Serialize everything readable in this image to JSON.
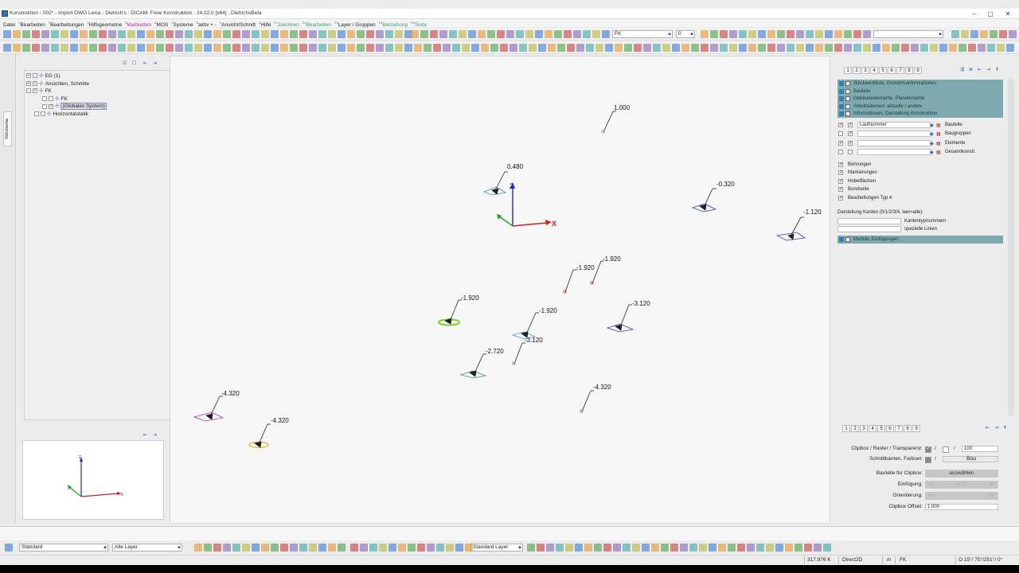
{
  "window": {
    "title": "Konstruktion - 002* - Import DWG Leica - Dietrich's : DICAM: Freie Konstruktion : 24.02.0 [x64] ,   DietrichsBeta"
  },
  "menu": [
    {
      "num": "",
      "label": "Datei",
      "color": "#222"
    },
    {
      "num": "2",
      "label": "Bearbeiten",
      "color": "#222"
    },
    {
      "num": "3",
      "label": "Bearbeitungen",
      "color": "#222"
    },
    {
      "num": "4",
      "label": "Hilfsgeometrie",
      "color": "#222"
    },
    {
      "num": "5",
      "label": "Maßketten",
      "color": "#b0309a"
    },
    {
      "num": "6",
      "label": "MOS",
      "color": "#222"
    },
    {
      "num": "7",
      "label": "Systeme",
      "color": "#222"
    },
    {
      "num": "8",
      "label": "aktiv + -",
      "color": "#222"
    },
    {
      "num": "9",
      "label": "Ansicht/Schnitt",
      "color": "#222"
    },
    {
      "num": "0",
      "label": "Hilfe",
      "color": "#222"
    },
    {
      "num": "F1",
      "label": "Zeichnen",
      "color": "#3aa07a"
    },
    {
      "num": "F2",
      "label": "Bearbeiten",
      "color": "#3aa07a"
    },
    {
      "num": "F3",
      "label": "Layer / Gruppen",
      "color": "#222"
    },
    {
      "num": "F4",
      "label": "Bemaßung",
      "color": "#3aa07a"
    },
    {
      "num": "F5",
      "label": "Texte",
      "color": "#3aa07a"
    }
  ],
  "toolbar": {
    "system_select": "FK",
    "number_select": "0",
    "empty_select": ""
  },
  "left_strip": {
    "tab": "Volumenta"
  },
  "tree": [
    {
      "label": "EG (1)",
      "indent": 0,
      "expander": "+",
      "checked": false,
      "selected": false
    },
    {
      "label": "Ansichten, Schnitte",
      "indent": 0,
      "expander": "+",
      "checked": true,
      "selected": false
    },
    {
      "label": "FK",
      "indent": 0,
      "expander": "-",
      "checked": true,
      "selected": false
    },
    {
      "label": "FK",
      "indent": 2,
      "expander": "",
      "checked": false,
      "selected": false
    },
    {
      "label": "(Globales System)",
      "indent": 2,
      "expander": "",
      "checked": true,
      "selected": true
    },
    {
      "label": "Horizontalstatik",
      "indent": 1,
      "expander": "",
      "checked": false,
      "selected": false
    }
  ],
  "canvas": {
    "labels": [
      {
        "text": "1.000",
        "color": "#c0c0c0"
      },
      {
        "text": "0.480",
        "color": "#4a8aa8"
      },
      {
        "text": "-0.320",
        "color": "#3a3ab0"
      },
      {
        "text": "-1.120",
        "color": "#3a3ab0"
      },
      {
        "text": "-1.920",
        "color": "#c04040"
      },
      {
        "text": "-1.920",
        "color": "#c04040"
      },
      {
        "text": "-1.920",
        "color": "#7ad030"
      },
      {
        "text": "-1.920",
        "color": "#4a9ad0"
      },
      {
        "text": "-3.120",
        "color": "#3a3ab0"
      },
      {
        "text": "-3.120",
        "color": "#8a8a8a"
      },
      {
        "text": "-2.720",
        "color": "#3a9a50"
      },
      {
        "text": "-4.320",
        "color": "#b030b0"
      },
      {
        "text": "-4.320",
        "color": "#e0b020"
      },
      {
        "text": "-4.320",
        "color": "#8a8a8a"
      }
    ],
    "axes": {
      "x": "X",
      "z": "Z"
    }
  },
  "mini_axes": {
    "x": "x",
    "z": "z"
  },
  "right_panel": {
    "sections": [
      {
        "label": "Stückwerkliste, Grundrissinformationen"
      },
      {
        "label": "Bauteile"
      },
      {
        "label": "Gebäudeelemente, Planelemente"
      },
      {
        "label": "Arbeitsebenen: aktuelle / andere"
      },
      {
        "label": "Informationen, Darstellung Konstruktion"
      }
    ],
    "info_rows": [
      {
        "field": "Laufnummer",
        "label": "Bauteile"
      },
      {
        "field": "",
        "label": "Baugruppen"
      },
      {
        "field": "",
        "label": "Elemente"
      },
      {
        "field": "",
        "label": "Gesamtkonstr."
      }
    ],
    "check_items": [
      "Bohrungen",
      "Markierungen",
      "Hobelflächen",
      "Bundseite",
      "Bearbeitungen Typ 4"
    ],
    "kanten_title": "Darstellung Kanten (0/1/2/3/4, leer=alle):",
    "kanten_rows": [
      "Kantentypnummern",
      "spezielle Linien"
    ],
    "module_section": "Module, Einfügungen",
    "tabs": [
      "1",
      "2",
      "3",
      "4",
      "5",
      "6",
      "7",
      "8",
      "9"
    ]
  },
  "clip_panel": {
    "tabs": [
      "1",
      "2",
      "3",
      "4",
      "5",
      "6",
      "7",
      "8",
      "9"
    ],
    "clipbox_label": "Clipbox / Raster / Transparenz:",
    "clipbox_value": "100",
    "schnitt_label": "Schnittkanten, Farbset:",
    "schnitt_value": "Blau",
    "bauteile_label": "Bauteile für Clipbox:",
    "auswaehlen": "auswählen",
    "einfuegung_label": "Einfügung:",
    "einfuegung_value": "0 / 0",
    "orientierung_label": "Orientierung:",
    "offset_label": "Clipbox Offset:",
    "offset_value": "1.000",
    "prev": "<<",
    "next": ">>"
  },
  "bottom_toolbar": {
    "standard": "Standard",
    "alle_layer": "Alle Layer",
    "standard_layer": "Standard Layer"
  },
  "statusbar": {
    "coord": "317.976 K",
    "renderer": "Direct2D",
    "unit": "m",
    "system": "FK",
    "angles": "O 15°/ 75°/251°/ 0°"
  }
}
